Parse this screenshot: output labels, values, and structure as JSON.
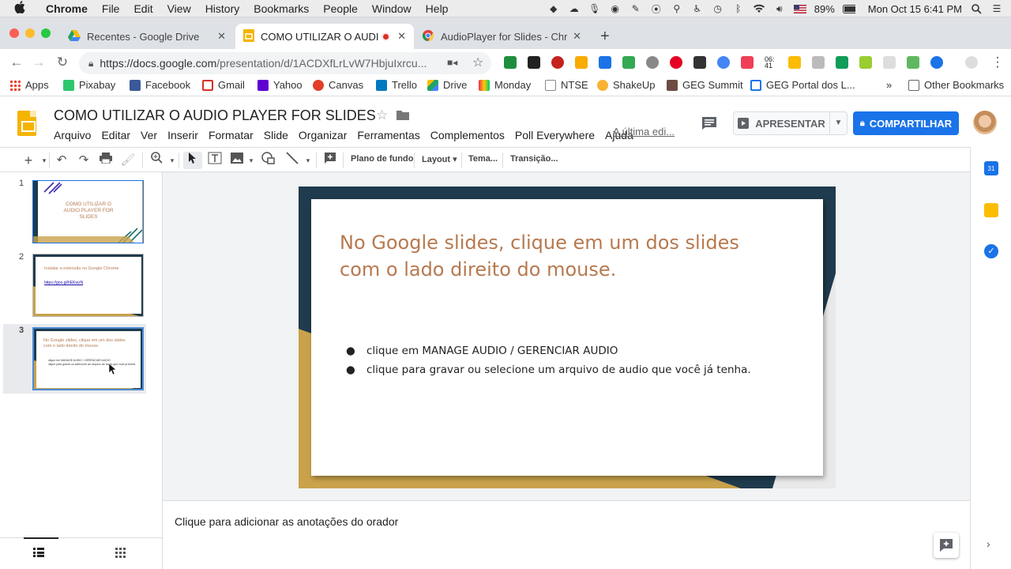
{
  "mac_menubar": {
    "app_name": "Chrome",
    "menus": [
      "File",
      "Edit",
      "View",
      "History",
      "Bookmarks",
      "People",
      "Window",
      "Help"
    ],
    "battery": "89%",
    "datetime": "Mon Oct 15  6:41 PM"
  },
  "browser": {
    "tabs": [
      {
        "title": "Recentes - Google Drive",
        "active": false
      },
      {
        "title": "COMO UTILIZAR O AUDIO",
        "active": true,
        "recording": true
      },
      {
        "title": "AudioPlayer for Slides - Chrom",
        "active": false
      }
    ],
    "new_tab": "+",
    "url": "https://docs.google.com/presentation/d/1ACDXfLrLvW7HbjuIxrcu...",
    "url_host": "https://docs.google.com",
    "url_path": "/presentation/d/1ACDXfLrLvW7HbjuIxrcu...",
    "bookmarks": [
      "Apps",
      "Pixabay",
      "Facebook",
      "Gmail",
      "Yahoo",
      "Canvas",
      "Trello",
      "Drive",
      "Monday",
      "NTSE",
      "ShakeUp",
      "GEG Summit",
      "GEG Portal dos L..."
    ],
    "bookmarks_more": "»",
    "other_bookmarks": "Other Bookmarks"
  },
  "slides_app": {
    "doc_title": "COMO UTILIZAR O AUDIO PLAYER FOR SLIDES",
    "menus": [
      "Arquivo",
      "Editar",
      "Ver",
      "Inserir",
      "Formatar",
      "Slide",
      "Organizar",
      "Ferramentas",
      "Complementos",
      "Poll Everywhere",
      "Ajuda"
    ],
    "last_edit": "A última edi...",
    "present_label": "APRESENTAR",
    "share_label": "COMPARTILHAR",
    "toolbar": {
      "background": "Plano de fundo",
      "layout": "Layout",
      "theme": "Tema...",
      "transition": "Transição..."
    }
  },
  "filmstrip": {
    "slides": [
      {
        "number": "1",
        "title": "COMO UTILIZAR O AUDIO PLAYER FOR SLIDES"
      },
      {
        "number": "2",
        "title": "Instalar a extensão no Google Chrome",
        "link": "https://goo.gl/hEKwzN"
      },
      {
        "number": "3",
        "title": "No Google slides, clique em um dos slides com o lado direito do mouse.",
        "bullets": [
          "clique em MANAGE AUDIO / GERENCIAR AUDIO",
          "clique para gravar ou selecione um arquivo de audio que você já tenha."
        ]
      }
    ],
    "selected": "3"
  },
  "current_slide": {
    "title": "No Google slides, clique em um dos slides com o lado direito do mouse.",
    "bullets": [
      "clique em MANAGE AUDIO / GERENCIAR AUDIO",
      "clique para gravar ou selecione um arquivo de audio que você já tenha."
    ],
    "colors": {
      "dark": "#1f3b4d",
      "gold": "#c9a24b",
      "title": "#b7794f"
    }
  },
  "notes": {
    "placeholder": "Clique para adicionar as anotações do orador"
  }
}
